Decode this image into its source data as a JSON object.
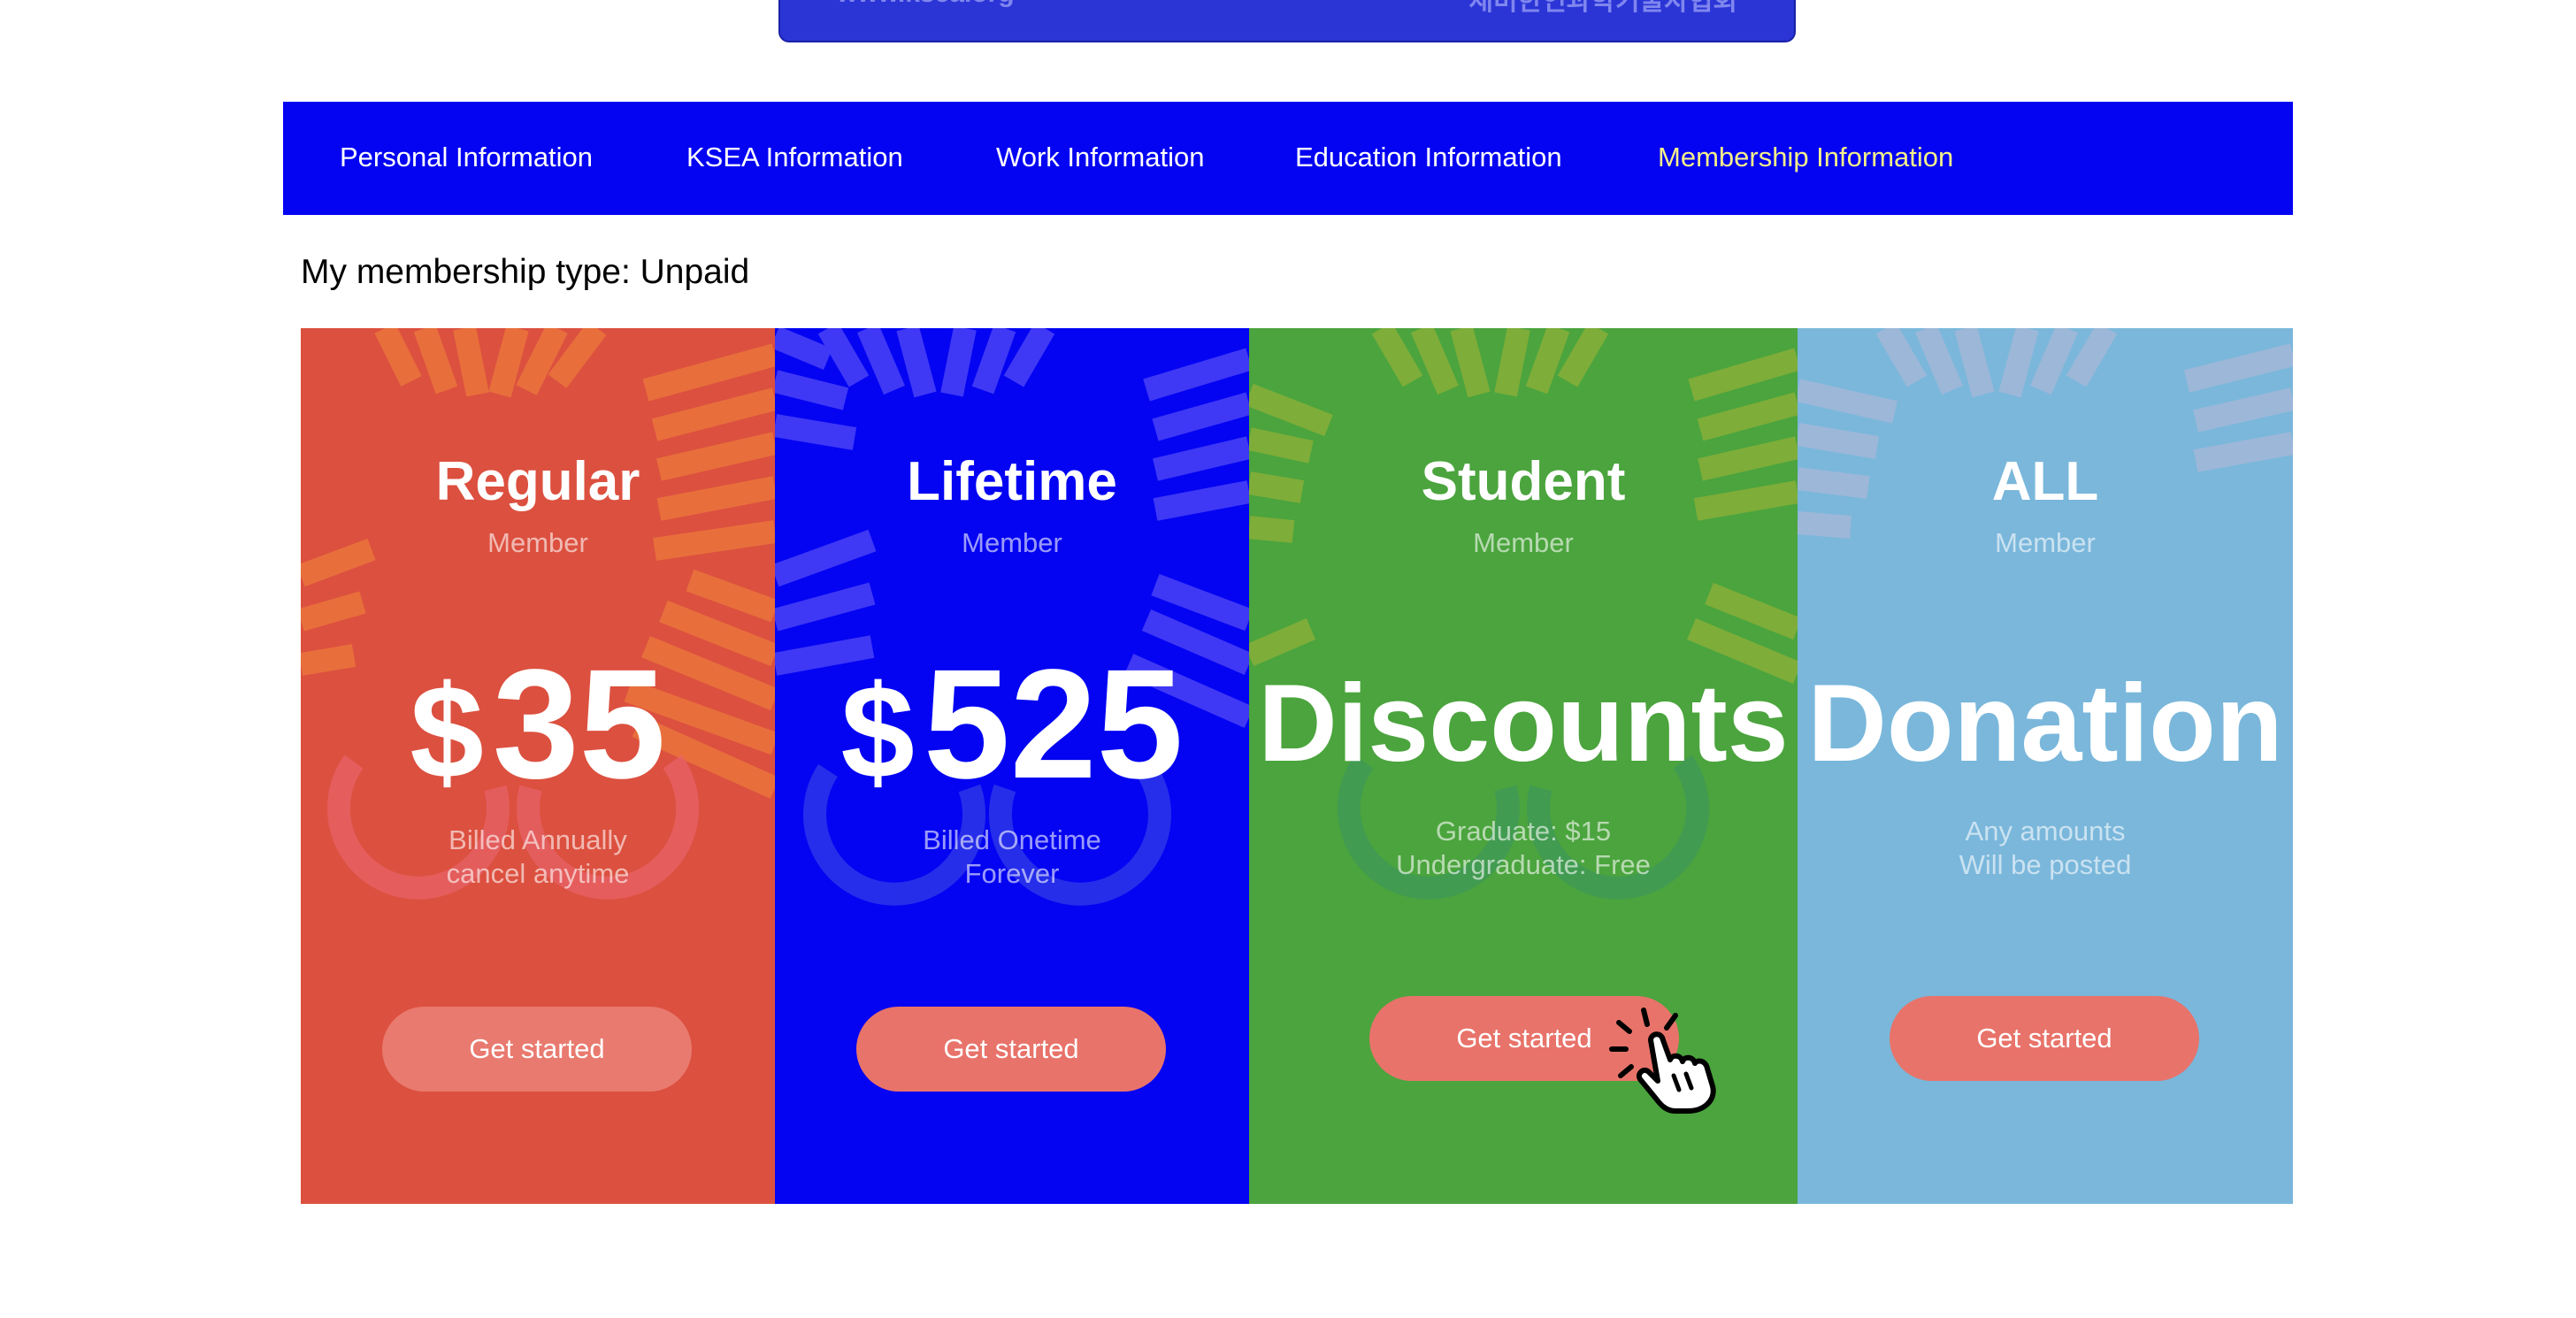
{
  "banner": {
    "left_text": "www.ksea.org",
    "right_text": "재미한인과학기술자협회"
  },
  "nav": {
    "items": [
      {
        "label": "Personal Information"
      },
      {
        "label": "KSEA Information"
      },
      {
        "label": "Work Information"
      },
      {
        "label": "Education Information"
      },
      {
        "label": "Membership Information",
        "active": true
      }
    ]
  },
  "membership_type": "My membership type: Unpaid",
  "cards": [
    {
      "title": "Regular",
      "subtitle": "Member",
      "currency": "$",
      "price": "35",
      "note1": "Billed Annually",
      "note2": "cancel anytime",
      "button": "Get started",
      "color": "#dc503f"
    },
    {
      "title": "Lifetime",
      "subtitle": "Member",
      "currency": "$",
      "price": "525",
      "note1": "Billed Onetime",
      "note2": "Forever",
      "button": "Get started",
      "color": "#0404f2"
    },
    {
      "title": "Student",
      "subtitle": "Member",
      "headline": "Discounts",
      "note1": "Graduate: $15",
      "note2": "Undergraduate: Free",
      "button": "Get started",
      "color": "#4ba43d"
    },
    {
      "title": "ALL",
      "subtitle": "Member",
      "headline": "Donation",
      "note1": "Any amounts",
      "note2": "Will be posted",
      "button": "Get started",
      "color": "#7ab7db"
    }
  ],
  "colors": {
    "nav_bg": "#0404f2",
    "nav_active": "#f6f08a",
    "button_bg": "#e8736a"
  },
  "icons": {
    "cursor": "pointer-hand-click-icon"
  }
}
